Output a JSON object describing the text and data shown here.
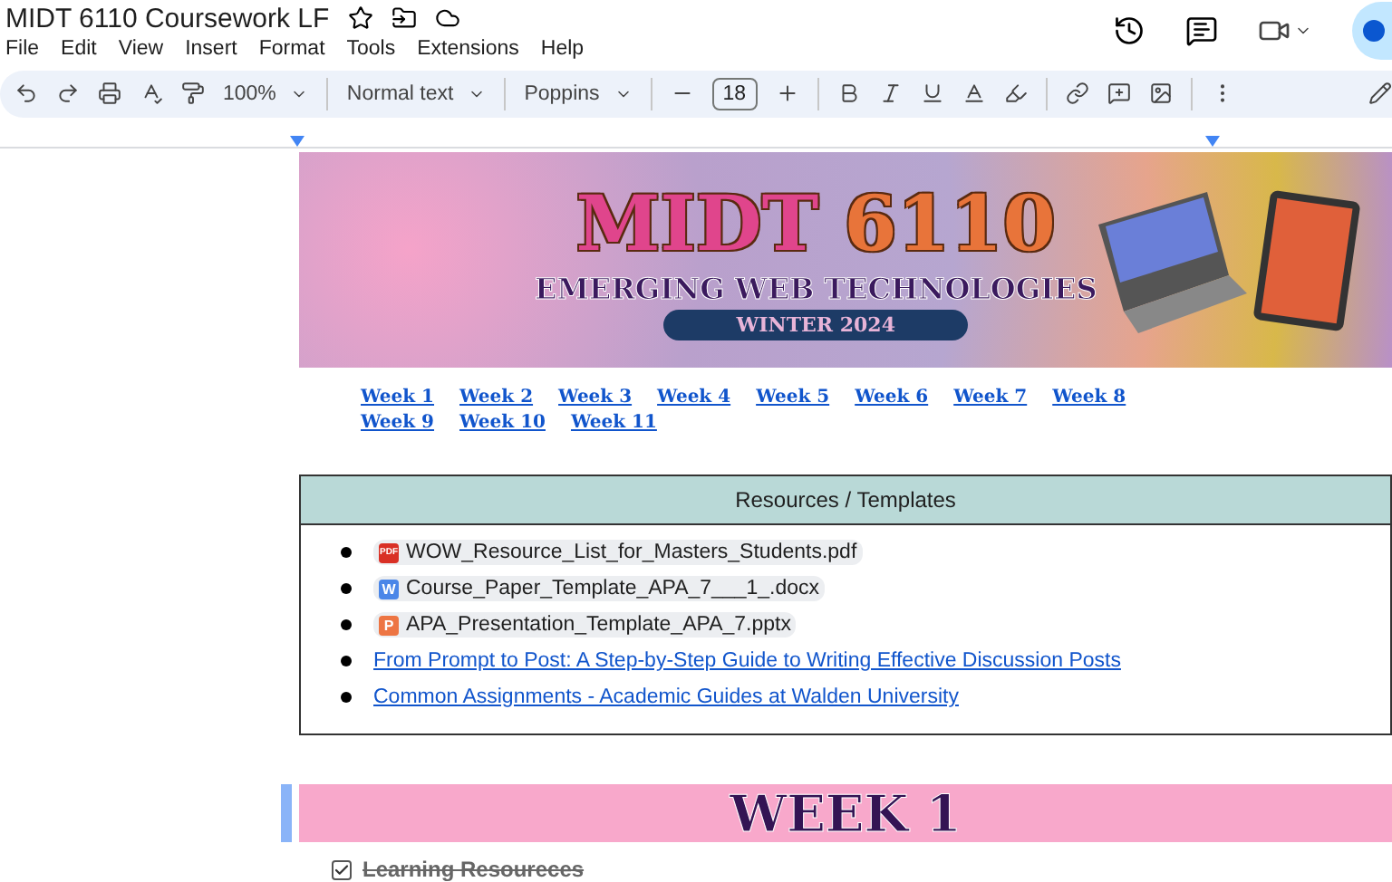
{
  "document": {
    "title": "MIDT 6110 Coursework LF"
  },
  "menu": [
    "File",
    "Edit",
    "View",
    "Insert",
    "Format",
    "Tools",
    "Extensions",
    "Help"
  ],
  "toolbar": {
    "zoom": "100%",
    "style": "Normal text",
    "font": "Poppins",
    "font_size": "18"
  },
  "banner": {
    "title": "MIDT",
    "number": "6110",
    "subtitle": "EMERGING WEB TECHNOLOGIES",
    "term": "WINTER 2024"
  },
  "week_links": [
    "Week 1",
    "Week 2",
    "Week 3",
    "Week 4",
    "Week 5",
    "Week 6",
    "Week 7",
    "Week 8",
    "Week 9",
    "Week 10",
    "Week 11"
  ],
  "resources": {
    "heading": "Resources / Templates",
    "items": [
      {
        "kind": "file",
        "badge": "PDF",
        "color": "#d93025",
        "label": "WOW_Resource_List_for_Masters_Students.pdf"
      },
      {
        "kind": "file",
        "badge": "W",
        "color": "#4a86e8",
        "label": "Course_Paper_Template_APA_7___1_.docx"
      },
      {
        "kind": "file",
        "badge": "P",
        "color": "#ed7543",
        "label": "APA_Presentation_Template_APA_7.pptx"
      },
      {
        "kind": "link",
        "label": "From Prompt to Post: A Step-by-Step Guide to Writing Effective Discussion Posts"
      },
      {
        "kind": "link",
        "label": "Common Assignments - Academic Guides at Walden University"
      }
    ]
  },
  "week_heading": "WEEK 1",
  "checklist": [
    {
      "label": "Learning Resoureces",
      "checked": true
    }
  ]
}
